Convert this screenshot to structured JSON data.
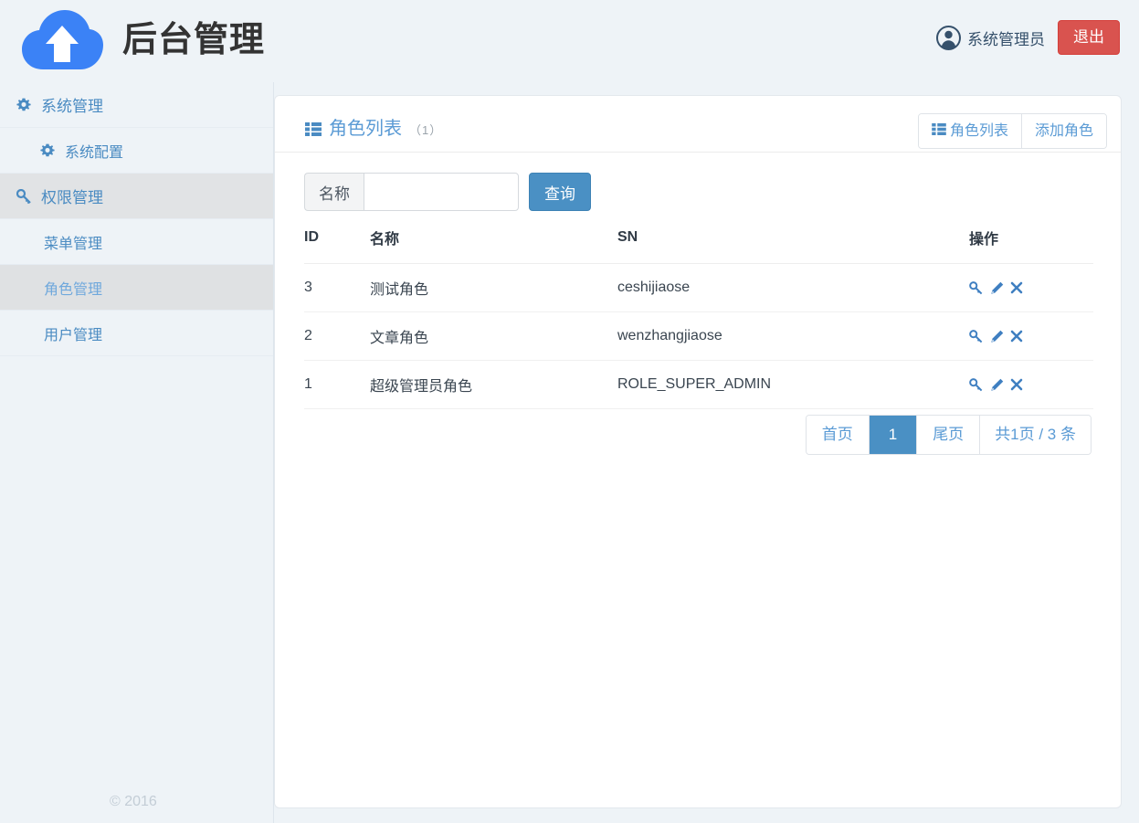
{
  "header": {
    "logo_icon": "cloud-upload-icon",
    "brand_title": "后台管理",
    "user_icon": "user-circle-icon",
    "user_name": "系统管理员",
    "logout_label": "退出"
  },
  "sidebar": {
    "items": [
      {
        "label": "系统管理",
        "icon": "gear-icon",
        "level": 1,
        "state": "normal"
      },
      {
        "label": "系统配置",
        "icon": "gear-icon",
        "level": 2,
        "state": "normal"
      },
      {
        "label": "权限管理",
        "icon": "key-icon",
        "level": 1,
        "state": "open"
      },
      {
        "label": "菜单管理",
        "icon": "none",
        "level": 2,
        "state": "normal"
      },
      {
        "label": "角色管理",
        "icon": "none",
        "level": 2,
        "state": "current"
      },
      {
        "label": "用户管理",
        "icon": "none",
        "level": 2,
        "state": "normal"
      }
    ],
    "copyright": "© 2016"
  },
  "panel": {
    "title_icon": "list-icon",
    "title": "角色列表",
    "count_label": "（1）",
    "buttons": [
      {
        "label": "角色列表",
        "icon": "list-icon"
      },
      {
        "label": "添加角色",
        "icon": "none"
      }
    ]
  },
  "search": {
    "addon_label": "名称",
    "value": "",
    "placeholder": "",
    "submit_label": "查询"
  },
  "table": {
    "columns": [
      "ID",
      "名称",
      "SN",
      "操作"
    ],
    "rows": [
      {
        "id": "3",
        "name": "测试角色",
        "sn": "ceshijiaose"
      },
      {
        "id": "2",
        "name": "文章角色",
        "sn": "wenzhangjiaose"
      },
      {
        "id": "1",
        "name": "超级管理员角色",
        "sn": "ROLE_SUPER_ADMIN"
      }
    ],
    "row_action_icons": [
      "key-icon",
      "pencil-icon",
      "times-icon"
    ]
  },
  "pagination": {
    "first_label": "首页",
    "current_page": "1",
    "last_label": "尾页",
    "summary": "共1页 / 3 条"
  },
  "colors": {
    "background": "#eef3f7",
    "accent_blue": "#4a90c4",
    "link_blue": "#5b9bd5",
    "danger_red": "#d9534f",
    "logo_blue": "#3b82f6",
    "text_dark": "#333333"
  }
}
